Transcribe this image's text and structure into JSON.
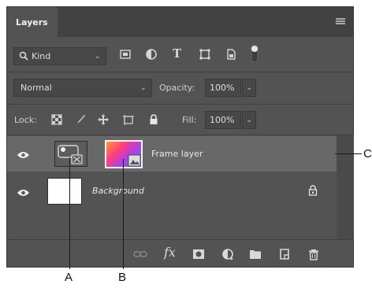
{
  "panel": {
    "tab_label": "Layers"
  },
  "filter": {
    "kind_label": "Kind"
  },
  "blend": {
    "mode": "Normal",
    "opacity_label": "Opacity:",
    "opacity_value": "100%"
  },
  "lock": {
    "lock_label": "Lock:",
    "fill_label": "Fill:",
    "fill_value": "100%"
  },
  "layers": [
    {
      "name": "Frame layer",
      "selected": true,
      "type": "frame"
    },
    {
      "name": "Background",
      "selected": false,
      "locked": true,
      "type": "background"
    }
  ],
  "footer_icons": [
    "link-icon",
    "fx-icon",
    "mask-icon",
    "adjustment-icon",
    "group-folder-icon",
    "new-layer-icon",
    "trash-icon"
  ],
  "callouts": {
    "a": "A",
    "b": "B",
    "c": "C"
  },
  "colors": {
    "panel_bg": "#535353",
    "selected_row": "#6a6a6a",
    "field_bg": "#474747"
  }
}
